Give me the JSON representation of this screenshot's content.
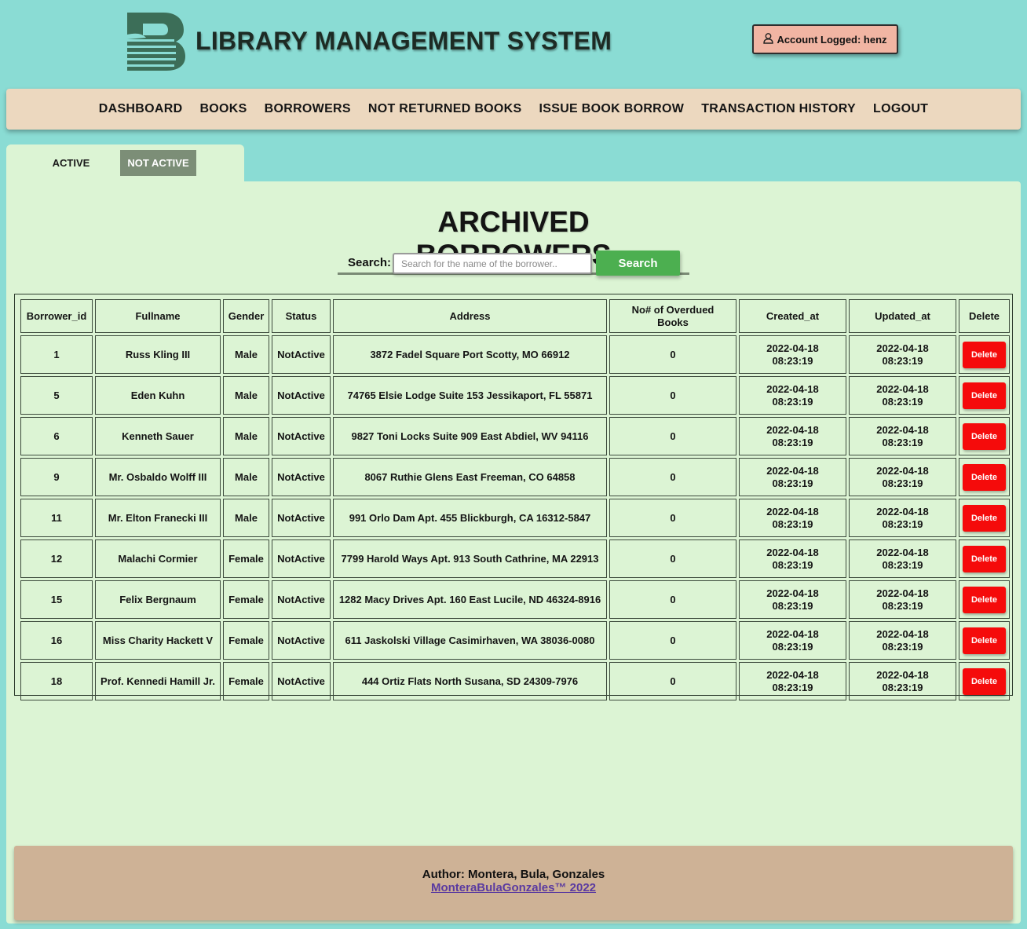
{
  "header": {
    "title": "LIBRARY MANAGEMENT SYSTEM",
    "account_label": "Account Logged: henz"
  },
  "nav": {
    "items": [
      {
        "label": "DASHBOARD"
      },
      {
        "label": "BOOKS"
      },
      {
        "label": "BORROWERS"
      },
      {
        "label": "NOT RETURNED BOOKS"
      },
      {
        "label": "ISSUE BOOK BORROW"
      },
      {
        "label": "TRANSACTION HISTORY"
      },
      {
        "label": "LOGOUT"
      }
    ]
  },
  "tabs": {
    "active": "ACTIVE",
    "not_active": "NOT ACTIVE"
  },
  "page": {
    "title": "ARCHIVED BORROWERS",
    "search_label": "Search:",
    "search_placeholder": "Search for the name of the borrower..",
    "search_button": "Search"
  },
  "table": {
    "headers": [
      "Borrower_id",
      "Fullname",
      "Gender",
      "Status",
      "Address",
      "No# of Overdued Books",
      "Created_at",
      "Updated_at",
      "Delete"
    ],
    "delete_label": "Delete",
    "rows": [
      {
        "id": "1",
        "fullname": "Russ Kling III",
        "gender": "Male",
        "status": "NotActive",
        "address": "3872 Fadel Square Port Scotty, MO 66912",
        "overdue": "0",
        "created": "2022-04-18 08:23:19",
        "updated": "2022-04-18 08:23:19"
      },
      {
        "id": "5",
        "fullname": "Eden Kuhn",
        "gender": "Male",
        "status": "NotActive",
        "address": "74765 Elsie Lodge Suite 153 Jessikaport, FL 55871",
        "overdue": "0",
        "created": "2022-04-18 08:23:19",
        "updated": "2022-04-18 08:23:19"
      },
      {
        "id": "6",
        "fullname": "Kenneth Sauer",
        "gender": "Male",
        "status": "NotActive",
        "address": "9827 Toni Locks Suite 909 East Abdiel, WV 94116",
        "overdue": "0",
        "created": "2022-04-18 08:23:19",
        "updated": "2022-04-18 08:23:19"
      },
      {
        "id": "9",
        "fullname": "Mr. Osbaldo Wolff III",
        "gender": "Male",
        "status": "NotActive",
        "address": "8067 Ruthie Glens East Freeman, CO 64858",
        "overdue": "0",
        "created": "2022-04-18 08:23:19",
        "updated": "2022-04-18 08:23:19"
      },
      {
        "id": "11",
        "fullname": "Mr. Elton Franecki III",
        "gender": "Male",
        "status": "NotActive",
        "address": "991 Orlo Dam Apt. 455 Blickburgh, CA 16312-5847",
        "overdue": "0",
        "created": "2022-04-18 08:23:19",
        "updated": "2022-04-18 08:23:19"
      },
      {
        "id": "12",
        "fullname": "Malachi Cormier",
        "gender": "Female",
        "status": "NotActive",
        "address": "7799 Harold Ways Apt. 913 South Cathrine, MA 22913",
        "overdue": "0",
        "created": "2022-04-18 08:23:19",
        "updated": "2022-04-18 08:23:19"
      },
      {
        "id": "15",
        "fullname": "Felix Bergnaum",
        "gender": "Female",
        "status": "NotActive",
        "address": "1282 Macy Drives Apt. 160 East Lucile, ND 46324-8916",
        "overdue": "0",
        "created": "2022-04-18 08:23:19",
        "updated": "2022-04-18 08:23:19"
      },
      {
        "id": "16",
        "fullname": "Miss Charity Hackett V",
        "gender": "Female",
        "status": "NotActive",
        "address": "611 Jaskolski Village Casimirhaven, WA 38036-0080",
        "overdue": "0",
        "created": "2022-04-18 08:23:19",
        "updated": "2022-04-18 08:23:19"
      },
      {
        "id": "18",
        "fullname": "Prof. Kennedi Hamill Jr.",
        "gender": "Female",
        "status": "NotActive",
        "address": "444 Ortiz Flats North Susana, SD 24309-7976",
        "overdue": "0",
        "created": "2022-04-18 08:23:19",
        "updated": "2022-04-18 08:23:19"
      }
    ]
  },
  "footer": {
    "author": "Author: Montera, Bula, Gonzales",
    "link": "MonteraBulaGonzales™ 2022"
  },
  "icons": {
    "logo": "library-logo",
    "account": "user-icon"
  },
  "colors": {
    "background": "#8adcd4",
    "navbar": "#ecd8bf",
    "panel": "#dcf4d4",
    "search_button": "#4caf50",
    "delete_button": "#f50b0b",
    "footer": "#ceb296",
    "account_badge": "#f1b5a3",
    "tab_selected": "#7c8e77"
  }
}
